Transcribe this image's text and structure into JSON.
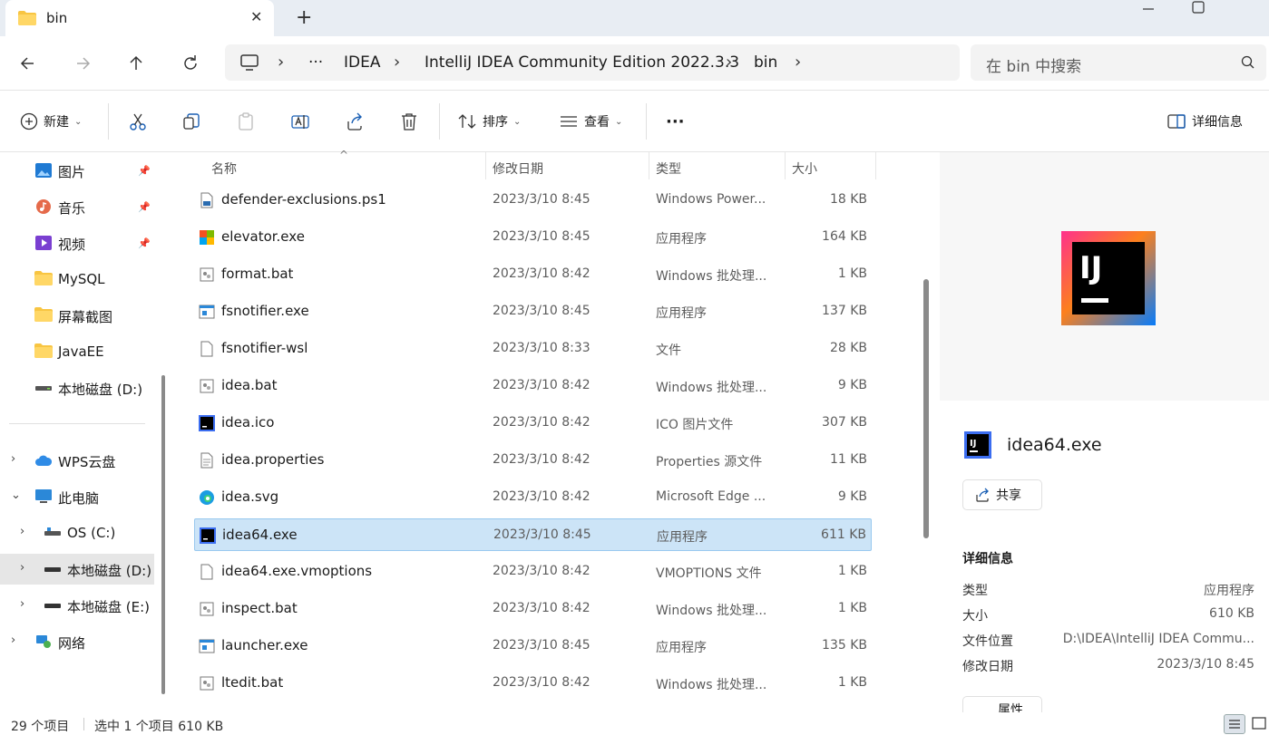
{
  "tab": {
    "title": "bin"
  },
  "breadcrumb": {
    "more": "···",
    "items": [
      "IDEA",
      "IntelliJ IDEA Community Edition 2022.3.3",
      "bin"
    ]
  },
  "search": {
    "placeholder": "在 bin 中搜索"
  },
  "toolbar": {
    "new_label": "新建",
    "sort_label": "排序",
    "view_label": "查看",
    "more_label": "···",
    "details_label": "详细信息"
  },
  "sidebar": {
    "items": [
      {
        "label": "图片"
      },
      {
        "label": "音乐"
      },
      {
        "label": "视频"
      },
      {
        "label": "MySQL"
      },
      {
        "label": "屏幕截图"
      },
      {
        "label": "JavaEE"
      },
      {
        "label": "本地磁盘 (D:)"
      },
      {
        "label": "WPS云盘"
      },
      {
        "label": "此电脑"
      },
      {
        "label": "OS (C:)"
      },
      {
        "label": "本地磁盘 (D:)"
      },
      {
        "label": "本地磁盘 (E:)"
      },
      {
        "label": "网络"
      }
    ]
  },
  "columns": {
    "name": "名称",
    "date": "修改日期",
    "type": "类型",
    "size": "大小"
  },
  "files": [
    {
      "name": "defender-exclusions.ps1",
      "date": "2023/3/10 8:45",
      "type": "Windows Power...",
      "size": "18 KB"
    },
    {
      "name": "elevator.exe",
      "date": "2023/3/10 8:45",
      "type": "应用程序",
      "size": "164 KB"
    },
    {
      "name": "format.bat",
      "date": "2023/3/10 8:42",
      "type": "Windows 批处理...",
      "size": "1 KB"
    },
    {
      "name": "fsnotifier.exe",
      "date": "2023/3/10 8:45",
      "type": "应用程序",
      "size": "137 KB"
    },
    {
      "name": "fsnotifier-wsl",
      "date": "2023/3/10 8:33",
      "type": "文件",
      "size": "28 KB"
    },
    {
      "name": "idea.bat",
      "date": "2023/3/10 8:42",
      "type": "Windows 批处理...",
      "size": "9 KB"
    },
    {
      "name": "idea.ico",
      "date": "2023/3/10 8:42",
      "type": "ICO 图片文件",
      "size": "307 KB"
    },
    {
      "name": "idea.properties",
      "date": "2023/3/10 8:42",
      "type": "Properties 源文件",
      "size": "11 KB"
    },
    {
      "name": "idea.svg",
      "date": "2023/3/10 8:42",
      "type": "Microsoft Edge ...",
      "size": "9 KB"
    },
    {
      "name": "idea64.exe",
      "date": "2023/3/10 8:45",
      "type": "应用程序",
      "size": "611 KB"
    },
    {
      "name": "idea64.exe.vmoptions",
      "date": "2023/3/10 8:42",
      "type": "VMOPTIONS 文件",
      "size": "1 KB"
    },
    {
      "name": "inspect.bat",
      "date": "2023/3/10 8:42",
      "type": "Windows 批处理...",
      "size": "1 KB"
    },
    {
      "name": "launcher.exe",
      "date": "2023/3/10 8:45",
      "type": "应用程序",
      "size": "135 KB"
    },
    {
      "name": "ltedit.bat",
      "date": "2023/3/10 8:42",
      "type": "Windows 批处理...",
      "size": "1 KB"
    }
  ],
  "preview": {
    "logo_text": "IJ"
  },
  "details": {
    "file_name": "idea64.exe",
    "share_label": "共享",
    "header": "详细信息",
    "rows": [
      {
        "key": "类型",
        "value": "应用程序"
      },
      {
        "key": "大小",
        "value": "610 KB"
      },
      {
        "key": "文件位置",
        "value": "D:\\IDEA\\IntelliJ IDEA Commu..."
      },
      {
        "key": "修改日期",
        "value": "2023/3/10 8:45"
      }
    ],
    "properties_label": "属性"
  },
  "status": {
    "count": "29 个项目",
    "selection": "选中 1 个项目  610 KB"
  },
  "colors": {
    "accent": "#0067c0",
    "selection": "#cce4f7",
    "folder": "#f8c542"
  }
}
